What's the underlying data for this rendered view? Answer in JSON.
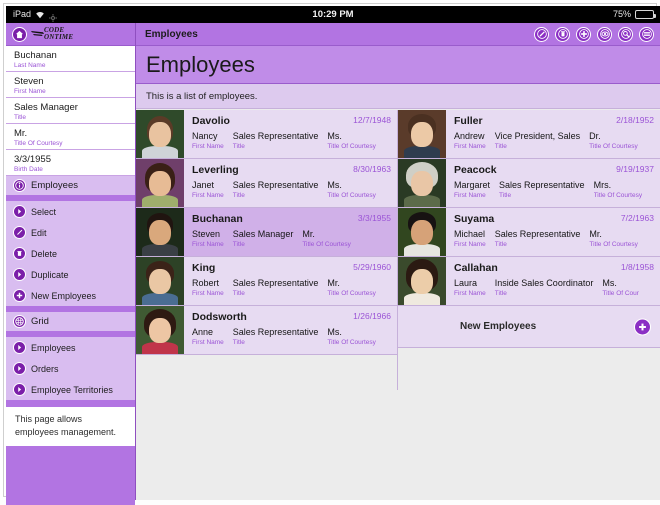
{
  "statusbar": {
    "device": "iPad",
    "wifi_icon": "wifi-icon",
    "location_icon": "location-icon",
    "time": "10:29 PM",
    "battery_percent": "75%",
    "battery_icon": "battery-icon"
  },
  "sidebar": {
    "home_icon": "home-icon",
    "logo_line1": "CODE",
    "logo_line2": "ONTIME",
    "record_fields": [
      {
        "value": "Buchanan",
        "caption": "Last Name"
      },
      {
        "value": "Steven",
        "caption": "First Name"
      },
      {
        "value": "Sales Manager",
        "caption": "Title"
      },
      {
        "value": "Mr.",
        "caption": "Title Of Courtesy"
      },
      {
        "value": "3/3/1955",
        "caption": "Birth Date"
      }
    ],
    "context_header": {
      "label": "Employees",
      "icon": "info-icon"
    },
    "actions": [
      {
        "label": "Select",
        "icon": "chevron-right-icon"
      },
      {
        "label": "Edit",
        "icon": "pencil-icon"
      },
      {
        "label": "Delete",
        "icon": "trash-icon"
      },
      {
        "label": "Duplicate",
        "icon": "chevron-right-icon"
      },
      {
        "label": "New Employees",
        "icon": "plus-icon"
      }
    ],
    "views_header": {
      "label": "Grid",
      "icon": "grid-icon"
    },
    "related": [
      {
        "label": "Employees",
        "icon": "chevron-right-icon"
      },
      {
        "label": "Orders",
        "icon": "chevron-right-icon"
      },
      {
        "label": "Employee Territories",
        "icon": "chevron-right-icon"
      }
    ],
    "note": "This page allows employees management."
  },
  "toolbar": {
    "title": "Employees",
    "icons": [
      {
        "name": "edit-icon",
        "label": "Edit"
      },
      {
        "name": "delete-icon",
        "label": "Delete"
      },
      {
        "name": "new-icon",
        "label": "New"
      },
      {
        "name": "view-icon",
        "label": "View"
      },
      {
        "name": "search-icon",
        "label": "Search"
      },
      {
        "name": "menu-icon",
        "label": "Menu"
      }
    ]
  },
  "page": {
    "heading": "Employees",
    "description": "This is a list of employees."
  },
  "grid": {
    "field_captions": {
      "first_name": "First Name",
      "title": "Title",
      "title_of_courtesy": "Title Of Courtesy"
    },
    "rows_left": [
      {
        "last_name": "Davolio",
        "birth_date": "12/7/1948",
        "first_name": "Nancy",
        "title": "Sales Representative",
        "title_of_courtesy": "Ms.",
        "caption_first_name": "First Name",
        "caption_title": "Title",
        "caption_toc": "Title Of Courtesy",
        "selected": false,
        "photo": {
          "hair": "#5b3b27",
          "bg": "#2f4a2a",
          "clothes": "#cfd4d8",
          "skin": "#e9c3a0"
        }
      },
      {
        "last_name": "Leverling",
        "birth_date": "8/30/1963",
        "first_name": "Janet",
        "title": "Sales Representative",
        "title_of_courtesy": "Ms.",
        "caption_first_name": "First Name",
        "caption_title": "Title",
        "caption_toc": "Title Of Courtesy",
        "selected": false,
        "photo": {
          "hair": "#3a2016",
          "bg": "#6f3f6a",
          "clothes": "#9fae6c",
          "skin": "#e7bb95"
        }
      },
      {
        "last_name": "Buchanan",
        "birth_date": "3/3/1955",
        "first_name": "Steven",
        "title": "Sales Manager",
        "title_of_courtesy": "Mr.",
        "caption_first_name": "First Name",
        "caption_title": "Title",
        "caption_toc": "Title Of Courtesy",
        "selected": true,
        "photo": {
          "hair": "#201410",
          "bg": "#1d2a1a",
          "clothes": "#3a3f45",
          "skin": "#d9a87c"
        }
      },
      {
        "last_name": "King",
        "birth_date": "5/29/1960",
        "first_name": "Robert",
        "title": "Sales Representative",
        "title_of_courtesy": "Mr.",
        "caption_first_name": "First Name",
        "caption_title": "Title",
        "caption_toc": "Title Of Courtesy",
        "selected": false,
        "photo": {
          "hair": "#3b2318",
          "bg": "#2d4226",
          "clothes": "#4a6d92",
          "skin": "#eac7a4"
        }
      },
      {
        "last_name": "Dodsworth",
        "birth_date": "1/26/1966",
        "first_name": "Anne",
        "title": "Sales Representative",
        "title_of_courtesy": "Ms.",
        "caption_first_name": "First Name",
        "caption_title": "Title",
        "caption_toc": "Title Of Courtesy",
        "selected": false,
        "photo": {
          "hair": "#2e1a12",
          "bg": "#3f5a33",
          "clothes": "#c0344a",
          "skin": "#edc6a4"
        }
      }
    ],
    "rows_right": [
      {
        "last_name": "Fuller",
        "birth_date": "2/18/1952",
        "first_name": "Andrew",
        "title": "Vice President, Sales",
        "title_of_courtesy": "Dr.",
        "caption_first_name": "First Name",
        "caption_title": "Title",
        "caption_toc": "Title Of Courtesy",
        "selected": false,
        "photo": {
          "hair": "#4a3021",
          "bg": "#5a3b2a",
          "clothes": "#2f3c4e",
          "skin": "#ecc9a6"
        }
      },
      {
        "last_name": "Peacock",
        "birth_date": "9/19/1937",
        "first_name": "Margaret",
        "title": "Sales Representative",
        "title_of_courtesy": "Mrs.",
        "caption_first_name": "First Name",
        "caption_title": "Title",
        "caption_toc": "Title Of Courtesy",
        "selected": false,
        "photo": {
          "hair": "#cfcfc6",
          "bg": "#2a3a24",
          "clothes": "#5c6b4a",
          "skin": "#e9c6a6"
        }
      },
      {
        "last_name": "Suyama",
        "birth_date": "7/2/1963",
        "first_name": "Michael",
        "title": "Sales Representative",
        "title_of_courtesy": "Mr.",
        "caption_first_name": "First Name",
        "caption_title": "Title",
        "caption_toc": "Title Of Courtesy",
        "selected": false,
        "photo": {
          "hair": "#171212",
          "bg": "#31461f",
          "clothes": "#e6e6e0",
          "skin": "#d6a278"
        }
      },
      {
        "last_name": "Callahan",
        "birth_date": "1/8/1958",
        "first_name": "Laura",
        "title": "Inside Sales Coordinator",
        "title_of_courtesy": "Ms.",
        "caption_first_name": "First Name",
        "caption_title": "Title",
        "caption_toc": "Title Of Cour",
        "selected": false,
        "photo": {
          "hair": "#2b1a12",
          "bg": "#3a4a2c",
          "clothes": "#efe9df",
          "skin": "#eccda9"
        }
      }
    ],
    "new_row": {
      "label": "New Employees",
      "icon": "plus-icon"
    }
  }
}
